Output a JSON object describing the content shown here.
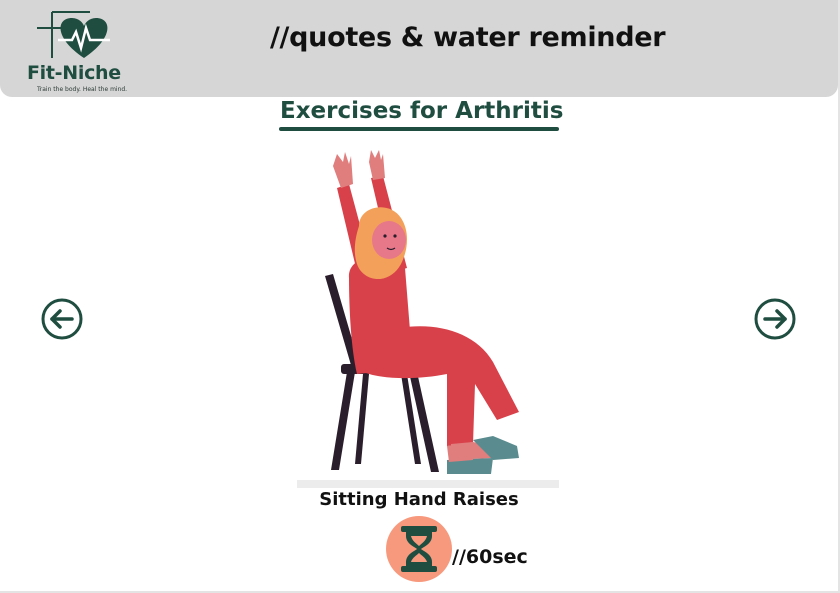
{
  "header": {
    "brand_name": "Fit-Niche",
    "tagline": "Train the body. Heal the mind.",
    "title": "//quotes & water reminder"
  },
  "main": {
    "section_title": "Exercises for Arthritis",
    "exercise_name": "Sitting Hand Raises",
    "duration": "//60sec",
    "illustration": "woman-in-hijab-raising-hands-on-chair"
  },
  "navigation": {
    "prev_icon": "arrow-left-circle-icon",
    "next_icon": "arrow-right-circle-icon"
  },
  "colors": {
    "brand": "#1f4d40",
    "header_bg": "#d6d6d6",
    "timer_bg": "#f7997d",
    "dress": "#d9414a",
    "hijab": "#f3a05a"
  }
}
